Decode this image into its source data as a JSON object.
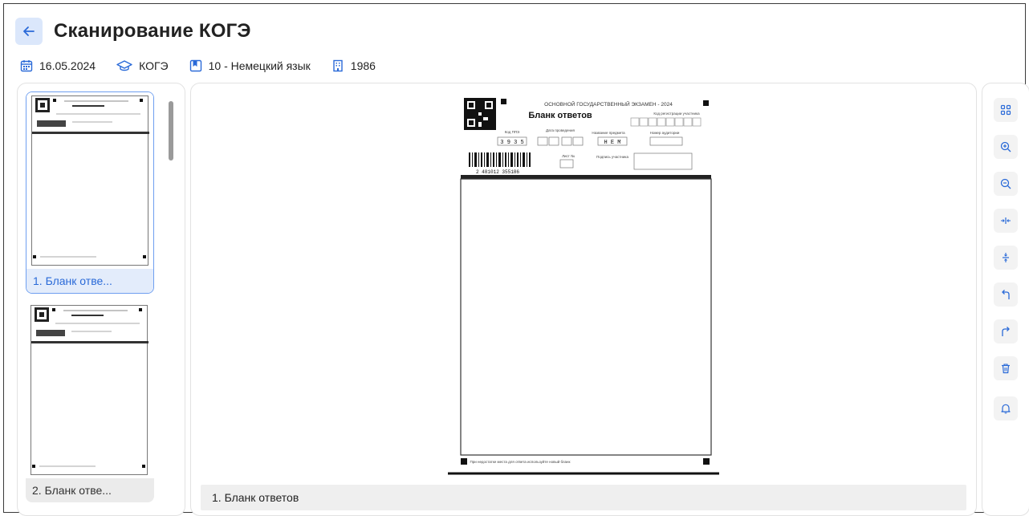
{
  "header": {
    "title": "Сканирование КОГЭ",
    "back_icon": "arrow-left-icon"
  },
  "meta": {
    "date": "16.05.2024",
    "exam": "КОГЭ",
    "subject": "10 - Немецкий язык",
    "code": "1986"
  },
  "thumbnails": [
    {
      "label": "1. Бланк отве...",
      "selected": true
    },
    {
      "label": "2. Бланк отве...",
      "selected": false
    }
  ],
  "viewer": {
    "caption": "1. Бланк ответов",
    "document": {
      "heading": "ОСНОВНОЙ ГОСУДАРСТВЕННЫЙ ЭКЗАМЕН - 2024",
      "form_title": "Бланк ответов",
      "participant_code_label": "Код регистрации участника",
      "ppe_label": "Код ППЭ",
      "ppe_value": "3 9 3 5",
      "date_label": "Дата проведения",
      "subject_label": "Название предмета",
      "subject_value": "Н Е М",
      "room_label": "Номер аудитории",
      "sheet_label": "Лист №",
      "signature_label": "Подпись участника",
      "barcode_text": "2 481012 355186",
      "footer_note": "При недостатке места для ответа используйте новый бланк"
    }
  },
  "toolbar": [
    {
      "name": "grid-view-button",
      "icon": "grid-icon"
    },
    {
      "name": "zoom-in-button",
      "icon": "zoom-in-icon"
    },
    {
      "name": "zoom-out-button",
      "icon": "zoom-out-icon"
    },
    {
      "name": "fit-width-button",
      "icon": "fit-width-icon"
    },
    {
      "name": "fit-height-button",
      "icon": "fit-height-icon"
    },
    {
      "name": "rotate-left-button",
      "icon": "rotate-left-icon"
    },
    {
      "name": "rotate-right-button",
      "icon": "rotate-right-icon"
    },
    {
      "name": "delete-button",
      "icon": "trash-icon"
    },
    {
      "name": "notify-button",
      "icon": "bell-icon"
    }
  ],
  "colors": {
    "accent": "#2a6ad8",
    "accent_light": "#dbe7fb",
    "selected_label_bg": "#e3ecfb"
  }
}
